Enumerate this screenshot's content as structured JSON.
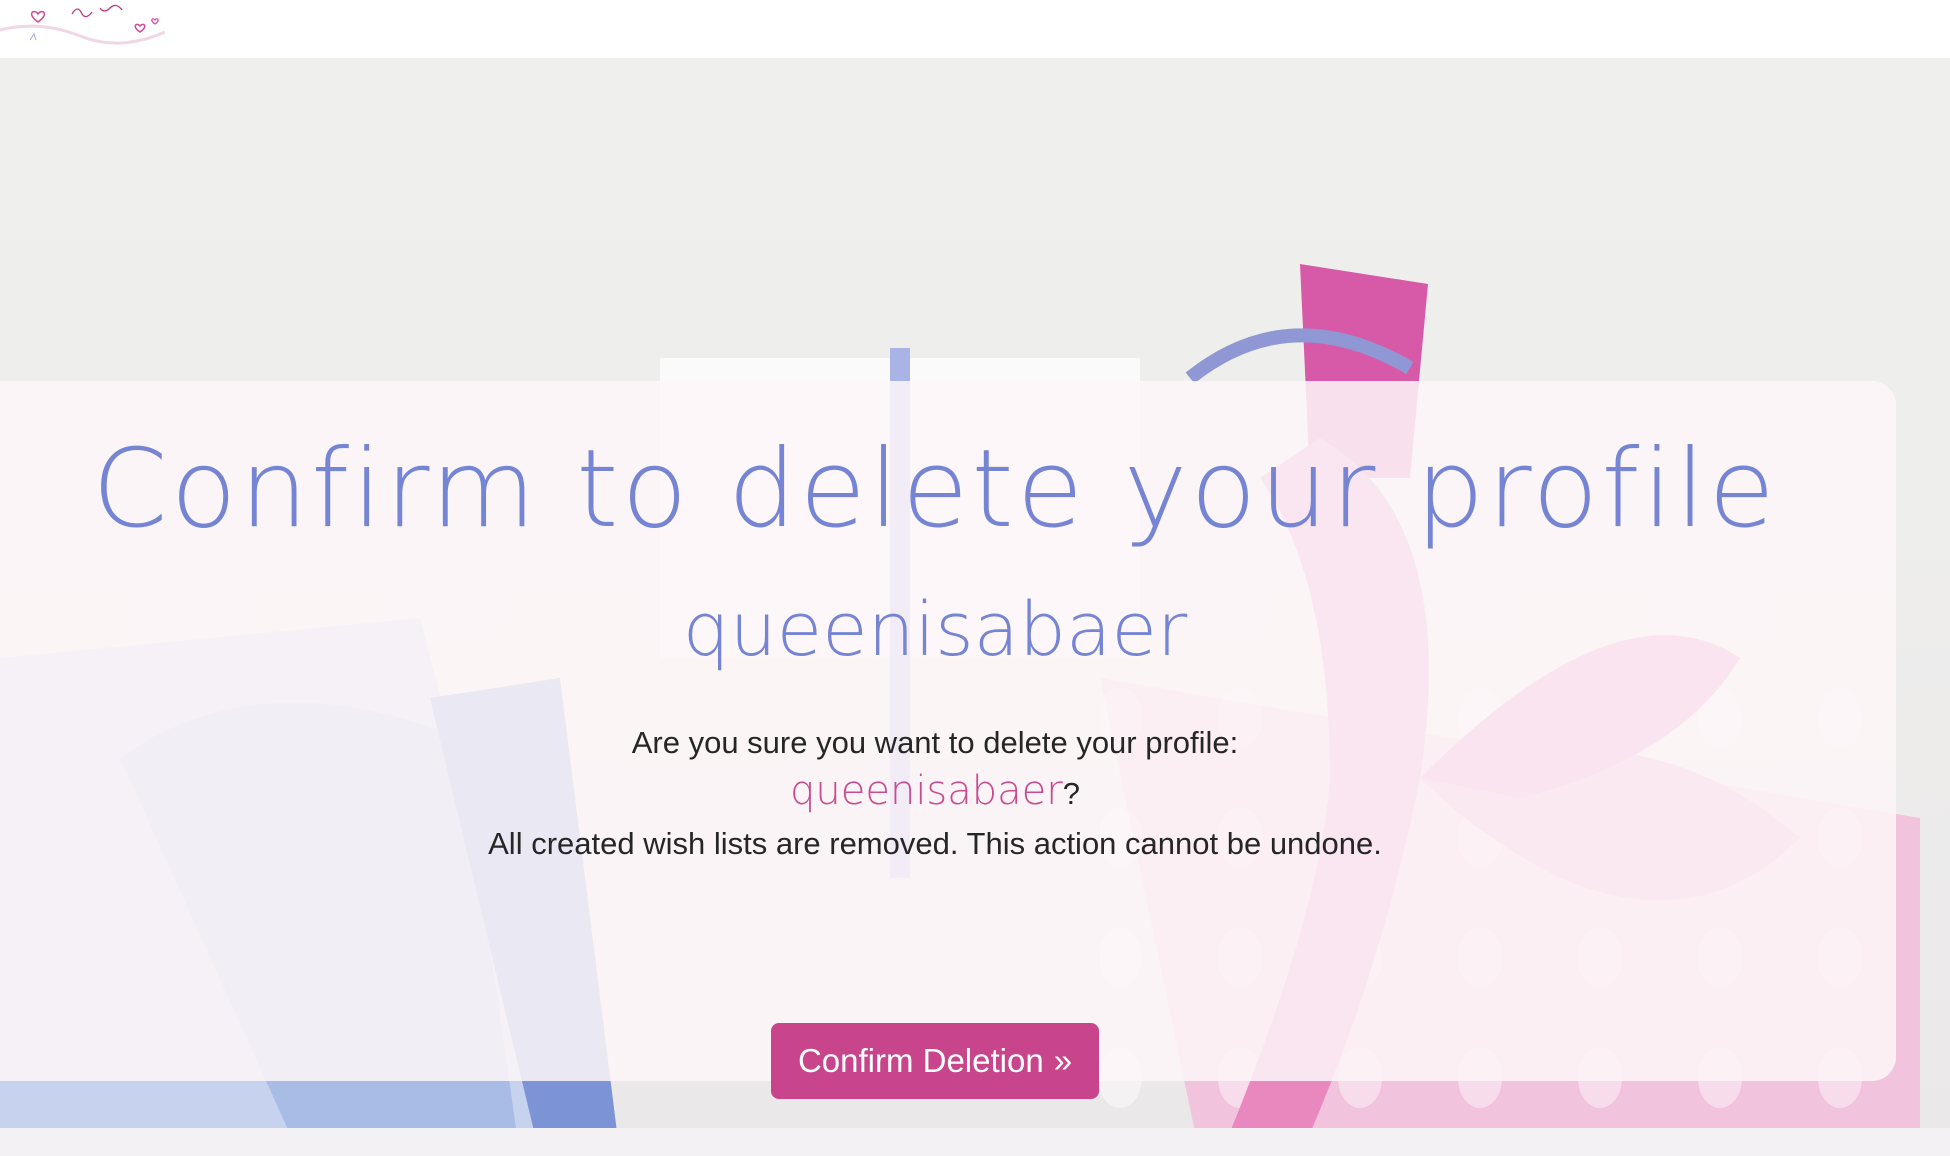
{
  "header": {
    "logo_alt": "Wish list Maker logo"
  },
  "dialog": {
    "title": "Confirm to delete your profile",
    "username_heading": "queenisabaer",
    "question_prefix": "Are you sure you want to delete your profile:",
    "question_username": "queenisabaer",
    "question_suffix": "?",
    "warning": "All created wish lists are removed. This action cannot be undone.",
    "confirm_label": "Confirm Deletion",
    "confirm_icon": "»"
  },
  "colors": {
    "accent_blue": "#7585d4",
    "accent_pink": "#c8458b"
  }
}
